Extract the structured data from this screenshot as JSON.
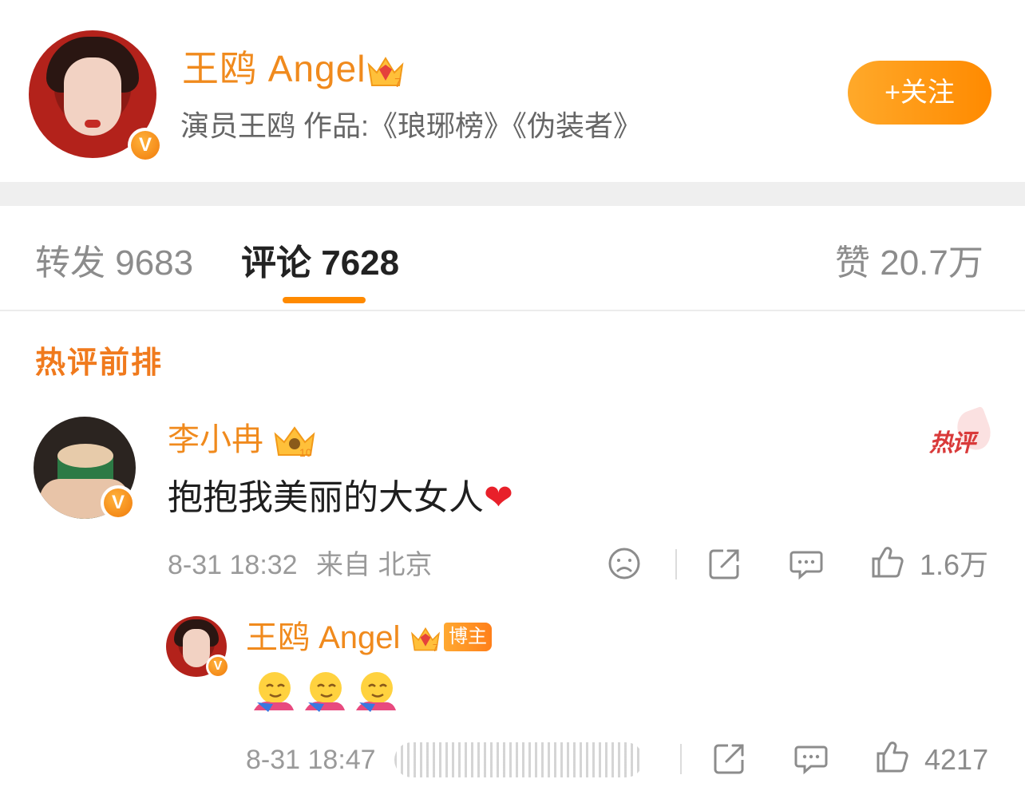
{
  "post_header": {
    "name": "王鸥 Angel",
    "crown_level": "7",
    "bio": "演员王鸥 作品:《琅琊榜》《伪装者》",
    "verified_mark": "V",
    "follow_label": "+关注"
  },
  "tabs": [
    {
      "label": "转发 9683",
      "active": false
    },
    {
      "label": "评论 7628",
      "active": true
    },
    {
      "label": "赞 20.7万",
      "active": false
    }
  ],
  "section_title": "热评前排",
  "comment": {
    "author": "李小冉",
    "crown_level": "10",
    "text": "抱抱我美丽的大女人",
    "heart": "❤",
    "hot_label": "热评",
    "time": "8-31 18:32",
    "source": "来自 北京",
    "like_count": "1.6万"
  },
  "reply": {
    "author": "王鸥 Angel",
    "crown_level": "7",
    "author_tag": "博主",
    "emojis": [
      "hug-emoji",
      "hug-emoji",
      "hug-emoji"
    ],
    "time": "8-31 18:47",
    "like_count": "4217"
  },
  "colors": {
    "accent": "#f08a1d",
    "follow_button": "#ff8a00",
    "hot_red": "#d93a3a",
    "heart_red": "#e8202a"
  }
}
